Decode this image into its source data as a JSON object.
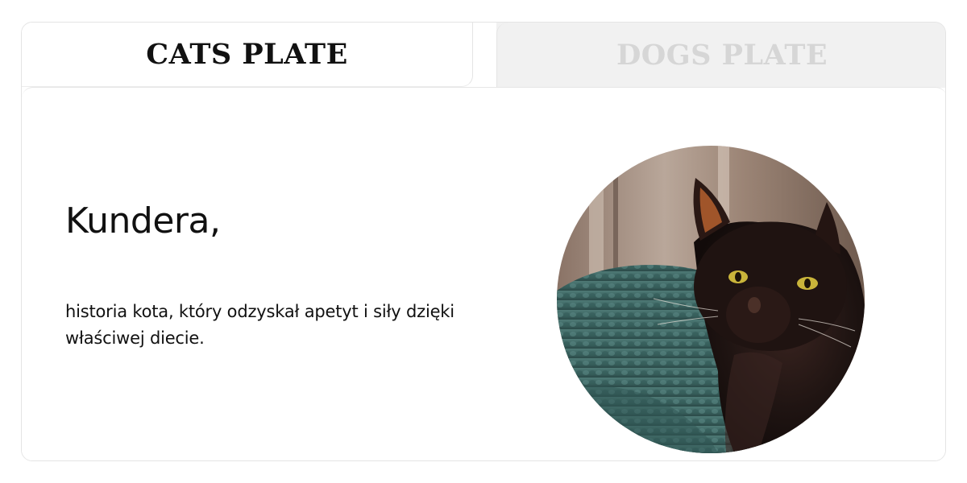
{
  "tabs": [
    {
      "label": "CATS PLATE",
      "active": true
    },
    {
      "label": "DOGS PLATE",
      "active": false
    }
  ],
  "content": {
    "title": "Kundera,",
    "description": "historia kota, który odzyskał apetyt i siły dzięki właściwej diecie.",
    "photo_subject": "black-cat-on-green-knit-blanket"
  },
  "colors": {
    "active_tab_text": "#111111",
    "inactive_tab_text": "#d6d6d6",
    "inactive_tab_bg": "#f1f1f1",
    "border": "#e4e4e4"
  }
}
